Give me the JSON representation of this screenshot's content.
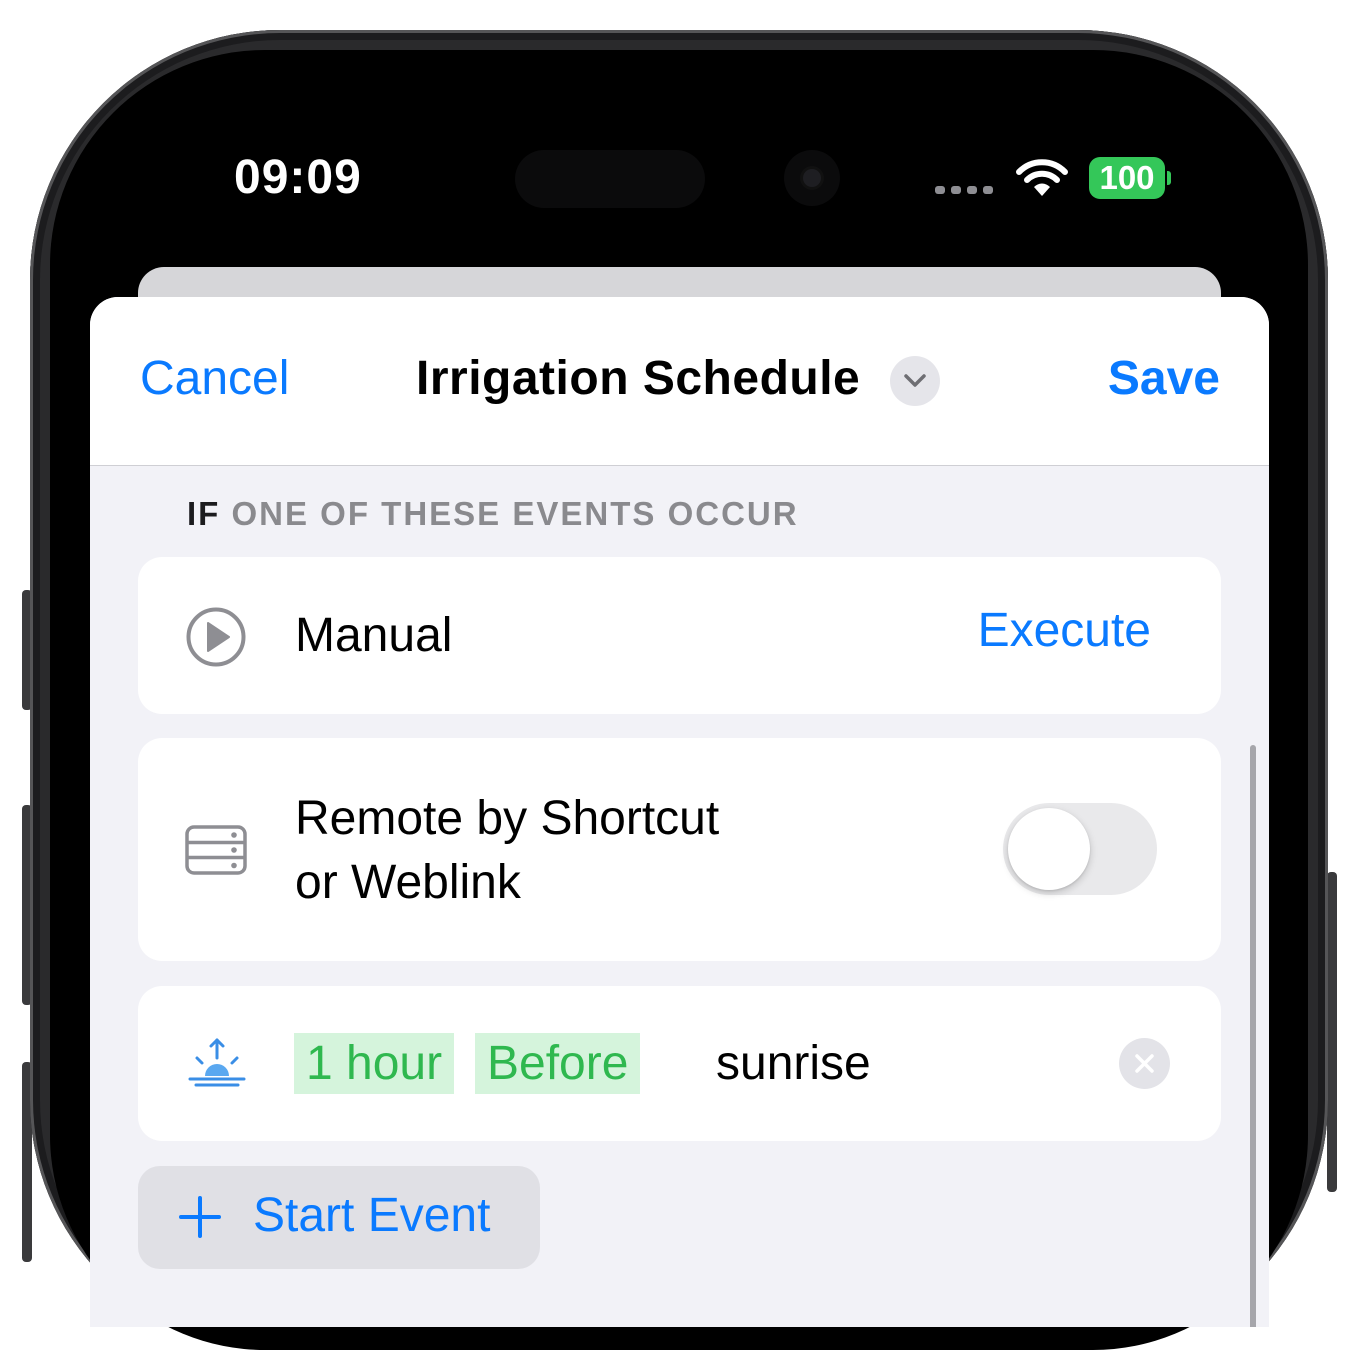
{
  "status_bar": {
    "time": "09:09",
    "battery": "100",
    "icons": [
      "signal-dots-icon",
      "wifi-icon",
      "battery-icon"
    ]
  },
  "nav": {
    "cancel": "Cancel",
    "title": "Irrigation Schedule",
    "save": "Save",
    "title_menu_icon": "chevron-down-icon"
  },
  "section": {
    "prefix": "IF",
    "rest": "ONE OF THESE EVENTS OCCUR"
  },
  "events": {
    "manual": {
      "icon": "play-circle-icon",
      "label": "Manual",
      "action": "Execute"
    },
    "remote": {
      "icon": "server-icon",
      "label_line1": "Remote by Shortcut",
      "label_line2": "or Weblink",
      "toggle_on": false
    },
    "sunrise": {
      "icon": "sunrise-icon",
      "offset": "1 hour",
      "relation": "Before",
      "event": "sunrise",
      "remove_icon": "close-icon"
    }
  },
  "add_event": {
    "label": "Start Event",
    "icon": "plus-icon"
  },
  "colors": {
    "accent": "#0a7aff",
    "chip_bg": "#d5f4dc",
    "chip_text": "#2fb84f",
    "battery": "#34c759",
    "group_bg": "#f2f2f7"
  }
}
